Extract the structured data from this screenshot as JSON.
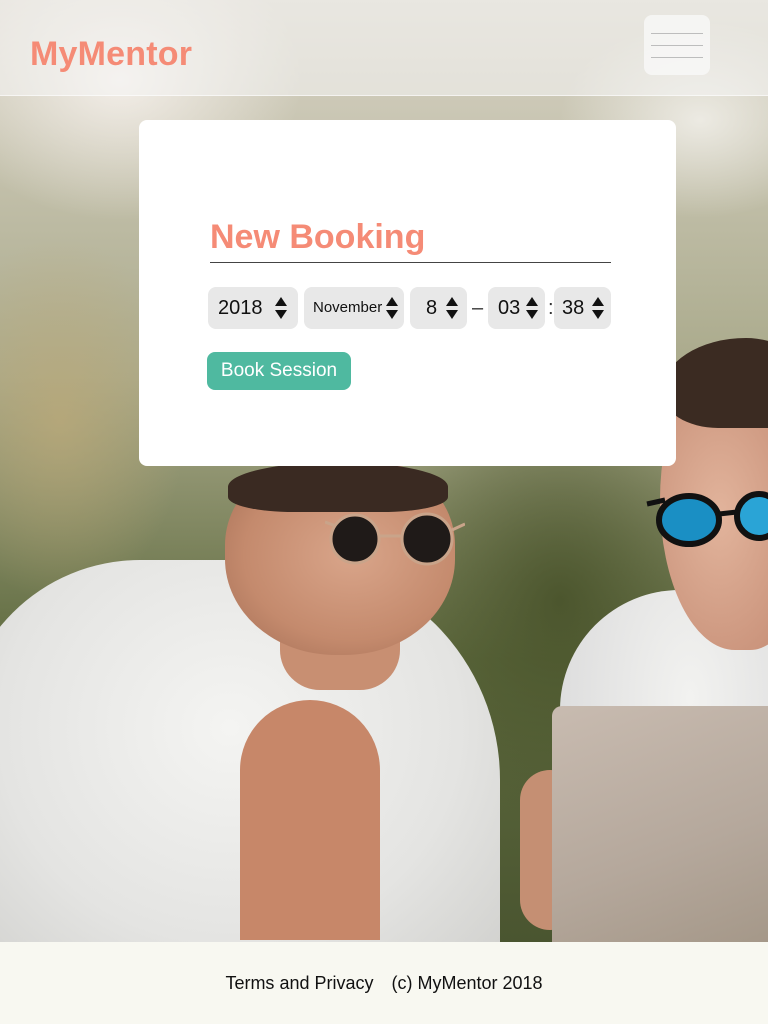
{
  "header": {
    "brand": "MyMentor",
    "menu_icon": "hamburger-menu-icon"
  },
  "booking": {
    "title": "New Booking",
    "year": "2018",
    "month": "November",
    "day": "8",
    "date_time_separator": "–",
    "hour": "03",
    "time_separator": ":",
    "minute": "38",
    "submit_label": "Book Session",
    "spinner_icon": "up-down-arrows-icon"
  },
  "footer": {
    "terms_link": "Terms and Privacy",
    "copyright": "(c) MyMentor 2018"
  },
  "colors": {
    "brand": "#f58b76",
    "button": "#4fb9a0",
    "picker_bg": "#e8e8e8",
    "footer_bg": "#f8f8f1"
  }
}
